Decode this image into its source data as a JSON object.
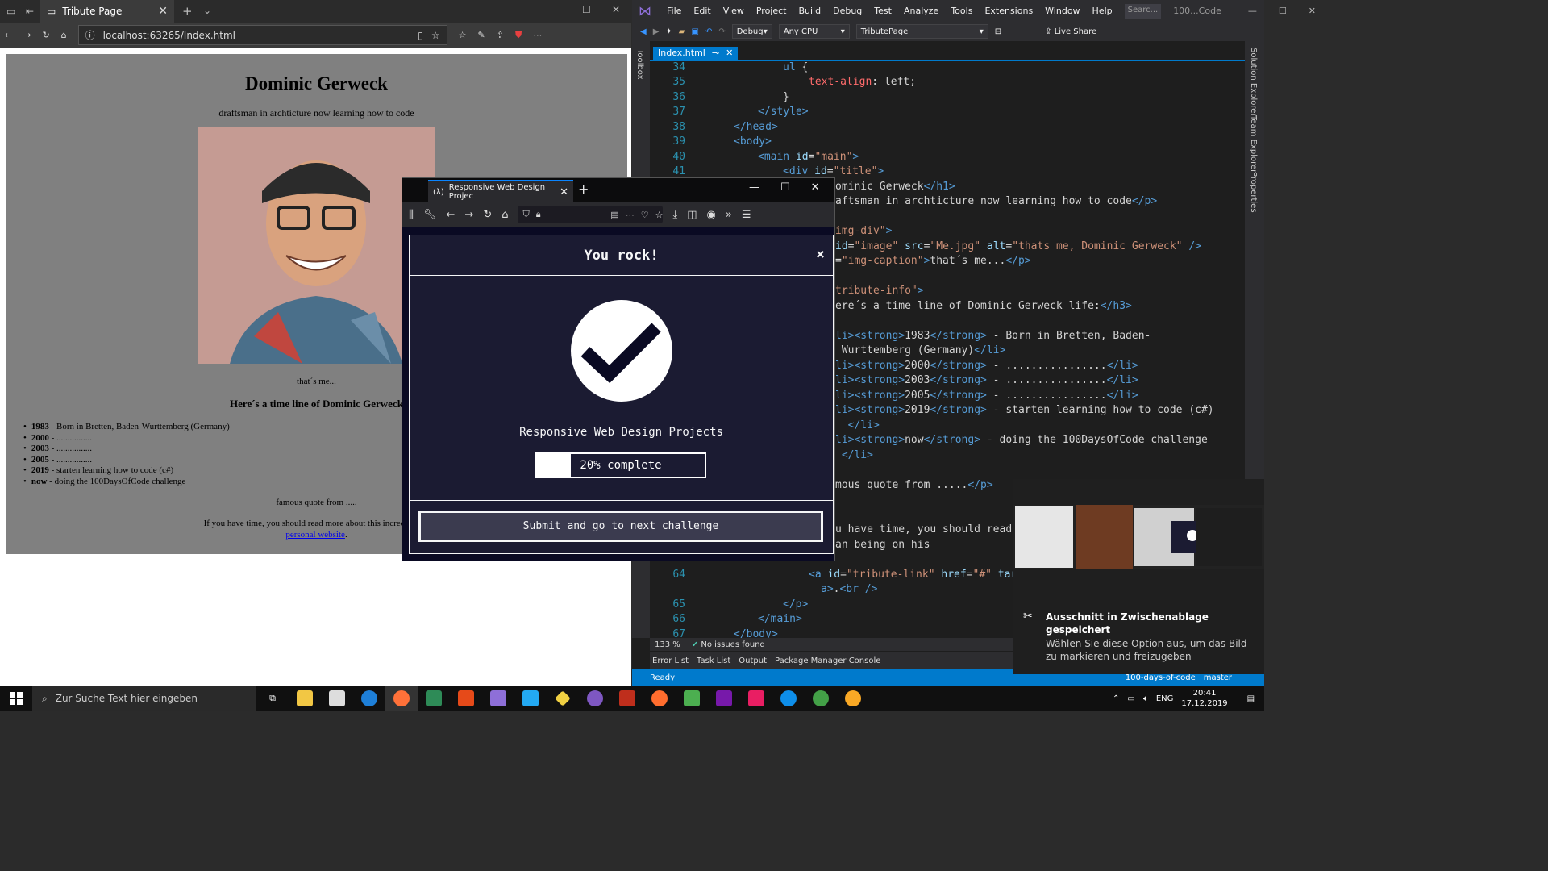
{
  "edge": {
    "tab_title": "Tribute Page",
    "url": "localhost:63265/Index.html"
  },
  "tribute": {
    "name": "Dominic Gerweck",
    "subtitle": "draftsman in archticture now learning how to code",
    "caption": "that´s me...",
    "timeline_heading": "Here´s a time line of Dominic Gerweck",
    "timeline": [
      {
        "year": "1983",
        "text": " - Born in Bretten, Baden-Wurttemberg (Germany)"
      },
      {
        "year": "2000",
        "text": " - ................"
      },
      {
        "year": "2003",
        "text": " - ................"
      },
      {
        "year": "2005",
        "text": " - ................"
      },
      {
        "year": "2019",
        "text": " - starten learning how to code (c#)"
      },
      {
        "year": "now",
        "text": " - doing the 100DaysOfCode challenge"
      }
    ],
    "quote": "famous quote from .....",
    "more_text": "If you have time, you should read more about this incredible hu",
    "link_text": "personal website",
    "link_suffix": "."
  },
  "vs": {
    "menu": [
      "File",
      "Edit",
      "View",
      "Project",
      "Build",
      "Debug",
      "Test",
      "Analyze",
      "Tools",
      "Extensions",
      "Window",
      "Help"
    ],
    "search": "Searc...",
    "solution_short": "100...Code",
    "config": "Debug",
    "platform": "Any CPU",
    "startup": "TributePage",
    "live_share": "Live Share",
    "file_tab": "Index.html",
    "toolbox": "Toolbox",
    "side_panels": [
      "Solution Explorer",
      "Team Explorer",
      "Properties"
    ],
    "zoom": "133 %",
    "issues": "No issues found",
    "bottom_tabs": [
      "Error List",
      "Task List",
      "Output",
      "Package Manager Console"
    ],
    "status_ready": "Ready",
    "status_repo": "100-days-of-code",
    "status_branch": "master"
  },
  "firefox": {
    "tab_title": "Responsive Web Design Projec",
    "modal_title": "You rock!",
    "close": "×",
    "certification": "Responsive Web Design Projects",
    "progress_label": "20% complete",
    "progress_fraction": 0.2,
    "submit_label": "Submit and go to next challenge"
  },
  "notification": {
    "title": "Ausschnitt in Zwischenablage gespeichert",
    "text": "Wählen Sie diese Option aus, um das Bild zu markieren und freizugeben"
  },
  "taskbar": {
    "search_placeholder": "Zur Suche Text hier eingeben",
    "lang": "ENG",
    "time": "20:41",
    "date": "17.12.2019"
  }
}
